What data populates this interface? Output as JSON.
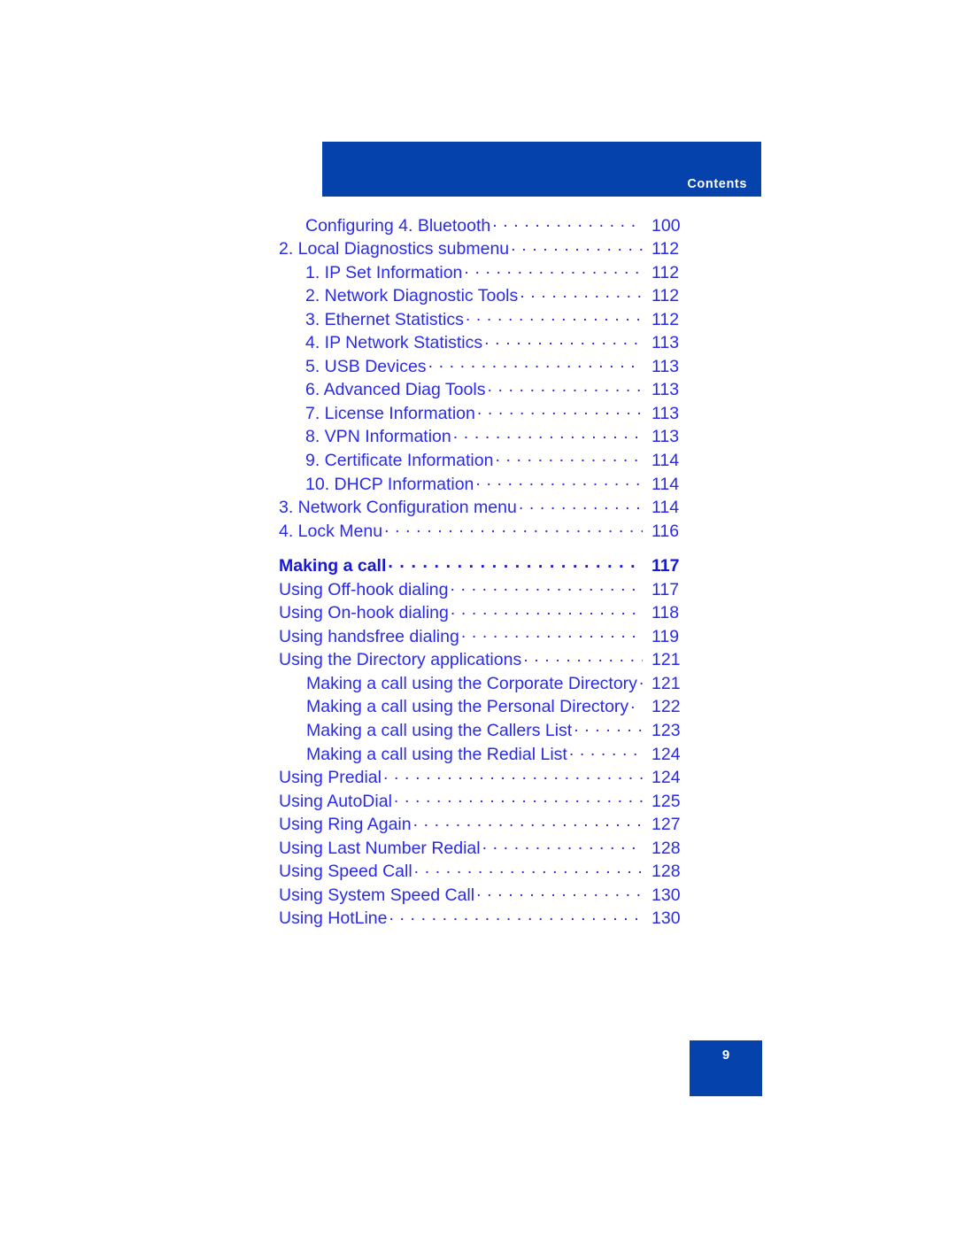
{
  "header": {
    "title": "Contents",
    "band_color": "#0542ab"
  },
  "footer": {
    "page_number": "9",
    "box_color": "#0542ab"
  },
  "colors": {
    "link_blue": "#2a2ae8",
    "heading_blue": "#1717d6",
    "brand_blue": "#0542ab"
  },
  "toc": {
    "entries": [
      {
        "label": "Configuring 4. Bluetooth",
        "page": "100",
        "level": 2,
        "bold": false,
        "gap_before": false
      },
      {
        "label": "2. Local Diagnostics submenu",
        "page": "112",
        "level": 1,
        "bold": false,
        "gap_before": false
      },
      {
        "label": "1. IP Set Information",
        "page": "112",
        "level": 2,
        "bold": false,
        "gap_before": false
      },
      {
        "label": "2. Network Diagnostic Tools",
        "page": "112",
        "level": 2,
        "bold": false,
        "gap_before": false
      },
      {
        "label": "3. Ethernet Statistics",
        "page": "112",
        "level": 2,
        "bold": false,
        "gap_before": false
      },
      {
        "label": "4. IP Network Statistics",
        "page": "113",
        "level": 2,
        "bold": false,
        "gap_before": false
      },
      {
        "label": "5. USB Devices",
        "page": "113",
        "level": 2,
        "bold": false,
        "gap_before": false
      },
      {
        "label": "6. Advanced Diag Tools",
        "page": "113",
        "level": 2,
        "bold": false,
        "gap_before": false
      },
      {
        "label": "7. License Information",
        "page": "113",
        "level": 2,
        "bold": false,
        "gap_before": false
      },
      {
        "label": "8. VPN Information",
        "page": "113",
        "level": 2,
        "bold": false,
        "gap_before": false
      },
      {
        "label": "9. Certificate Information",
        "page": "114",
        "level": 2,
        "bold": false,
        "gap_before": false
      },
      {
        "label": "10. DHCP Information",
        "page": "114",
        "level": 2,
        "bold": false,
        "gap_before": false
      },
      {
        "label": "3. Network Configuration menu",
        "page": "114",
        "level": 1,
        "bold": false,
        "gap_before": false
      },
      {
        "label": "4. Lock Menu",
        "page": "116",
        "level": 1,
        "bold": false,
        "gap_before": false
      },
      {
        "label": "Making a call",
        "page": "117",
        "level": 1,
        "bold": true,
        "gap_before": true
      },
      {
        "label": "Using Off-hook dialing",
        "page": "117",
        "level": 1,
        "bold": false,
        "gap_before": false
      },
      {
        "label": "Using On-hook dialing",
        "page": "118",
        "level": 1,
        "bold": false,
        "gap_before": false
      },
      {
        "label": "Using handsfree dialing",
        "page": "119",
        "level": 1,
        "bold": false,
        "gap_before": false
      },
      {
        "label": "Using the Directory applications",
        "page": "121",
        "level": 1,
        "bold": false,
        "gap_before": false
      },
      {
        "label": "Making a call using the Corporate Directory",
        "page": "121",
        "level": 3,
        "bold": false,
        "gap_before": false
      },
      {
        "label": "Making a call using the Personal Directory",
        "page": "122",
        "level": 3,
        "bold": false,
        "gap_before": false
      },
      {
        "label": "Making a call using the Callers List",
        "page": "123",
        "level": 3,
        "bold": false,
        "gap_before": false
      },
      {
        "label": "Making a call using the Redial List",
        "page": "124",
        "level": 3,
        "bold": false,
        "gap_before": false
      },
      {
        "label": "Using Predial",
        "page": "124",
        "level": 1,
        "bold": false,
        "gap_before": false
      },
      {
        "label": "Using AutoDial",
        "page": "125",
        "level": 1,
        "bold": false,
        "gap_before": false
      },
      {
        "label": "Using Ring Again",
        "page": "127",
        "level": 1,
        "bold": false,
        "gap_before": false
      },
      {
        "label": "Using Last Number Redial",
        "page": "128",
        "level": 1,
        "bold": false,
        "gap_before": false
      },
      {
        "label": "Using Speed Call",
        "page": "128",
        "level": 1,
        "bold": false,
        "gap_before": false
      },
      {
        "label": "Using System Speed Call",
        "page": "130",
        "level": 1,
        "bold": false,
        "gap_before": false
      },
      {
        "label": "Using HotLine",
        "page": "130",
        "level": 1,
        "bold": false,
        "gap_before": false
      }
    ]
  }
}
